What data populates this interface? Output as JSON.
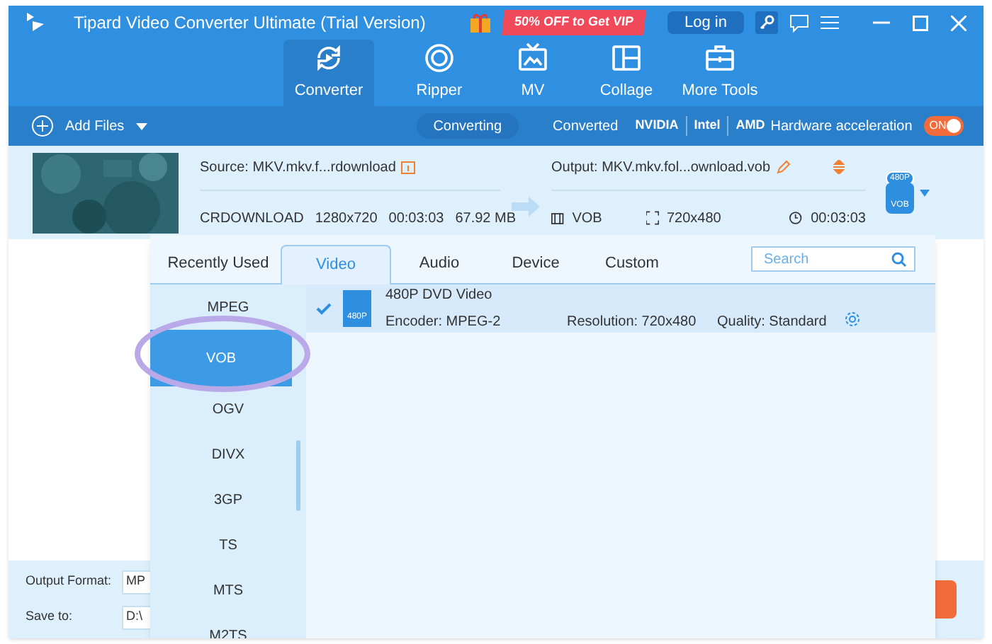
{
  "window": {
    "title": "Tipard Video Converter Ultimate (Trial Version)",
    "promo": "50% OFF to Get VIP",
    "login": "Log in"
  },
  "nav": [
    {
      "label": "Converter",
      "selected": true,
      "kind": "convert"
    },
    {
      "label": "Ripper",
      "selected": false,
      "kind": "disc"
    },
    {
      "label": "MV",
      "selected": false,
      "kind": "tv"
    },
    {
      "label": "Collage",
      "selected": false,
      "kind": "collage"
    },
    {
      "label": "More Tools",
      "selected": false,
      "kind": "toolbox"
    }
  ],
  "toolbar": {
    "add_files": "Add Files",
    "modes": [
      {
        "label": "Converting",
        "selected": true
      },
      {
        "label": "Converted",
        "selected": false
      }
    ],
    "vendors": [
      "NVIDIA",
      "Intel",
      "AMD"
    ],
    "hw_label": "Hardware acceleration",
    "hw_on": true,
    "hw_text": "ON"
  },
  "file": {
    "source": "Source: MKV.mkv.f...rdownload",
    "output": "Output: MKV.mkv.fol...ownload.vob",
    "src_format": "CRDOWNLOAD",
    "src_res": "1280x720",
    "src_dur": "00:03:03",
    "src_size": "67.92 MB",
    "out_format": "VOB",
    "out_res": "720x480",
    "out_dur": "00:03:03",
    "badge_top": "480P",
    "badge_bottom": "VOB"
  },
  "dropdown": {
    "tabs": [
      {
        "label": "Recently Used",
        "selected": false
      },
      {
        "label": "Video",
        "selected": true
      },
      {
        "label": "Audio",
        "selected": false
      },
      {
        "label": "Device",
        "selected": false
      },
      {
        "label": "Custom",
        "selected": false
      }
    ],
    "search": {
      "placeholder": "Search"
    },
    "formats": [
      {
        "label": "MPEG",
        "selected": false
      },
      {
        "label": "VOB",
        "selected": true
      },
      {
        "label": "OGV",
        "selected": false
      },
      {
        "label": "DIVX",
        "selected": false
      },
      {
        "label": "3GP",
        "selected": false
      },
      {
        "label": "TS",
        "selected": false
      },
      {
        "label": "MTS",
        "selected": false
      },
      {
        "label": "M2TS",
        "selected": false
      }
    ],
    "presets": [
      {
        "checked": true,
        "badge": "480P",
        "name": "480P DVD Video",
        "encoder": "Encoder: MPEG-2",
        "resolution": "Resolution: 720x480",
        "quality": "Quality: Standard"
      }
    ]
  },
  "bottom": {
    "output_format_label": "Output Format:",
    "output_format_value": "MP",
    "save_to_label": "Save to:",
    "save_to_value": "D:\\"
  }
}
